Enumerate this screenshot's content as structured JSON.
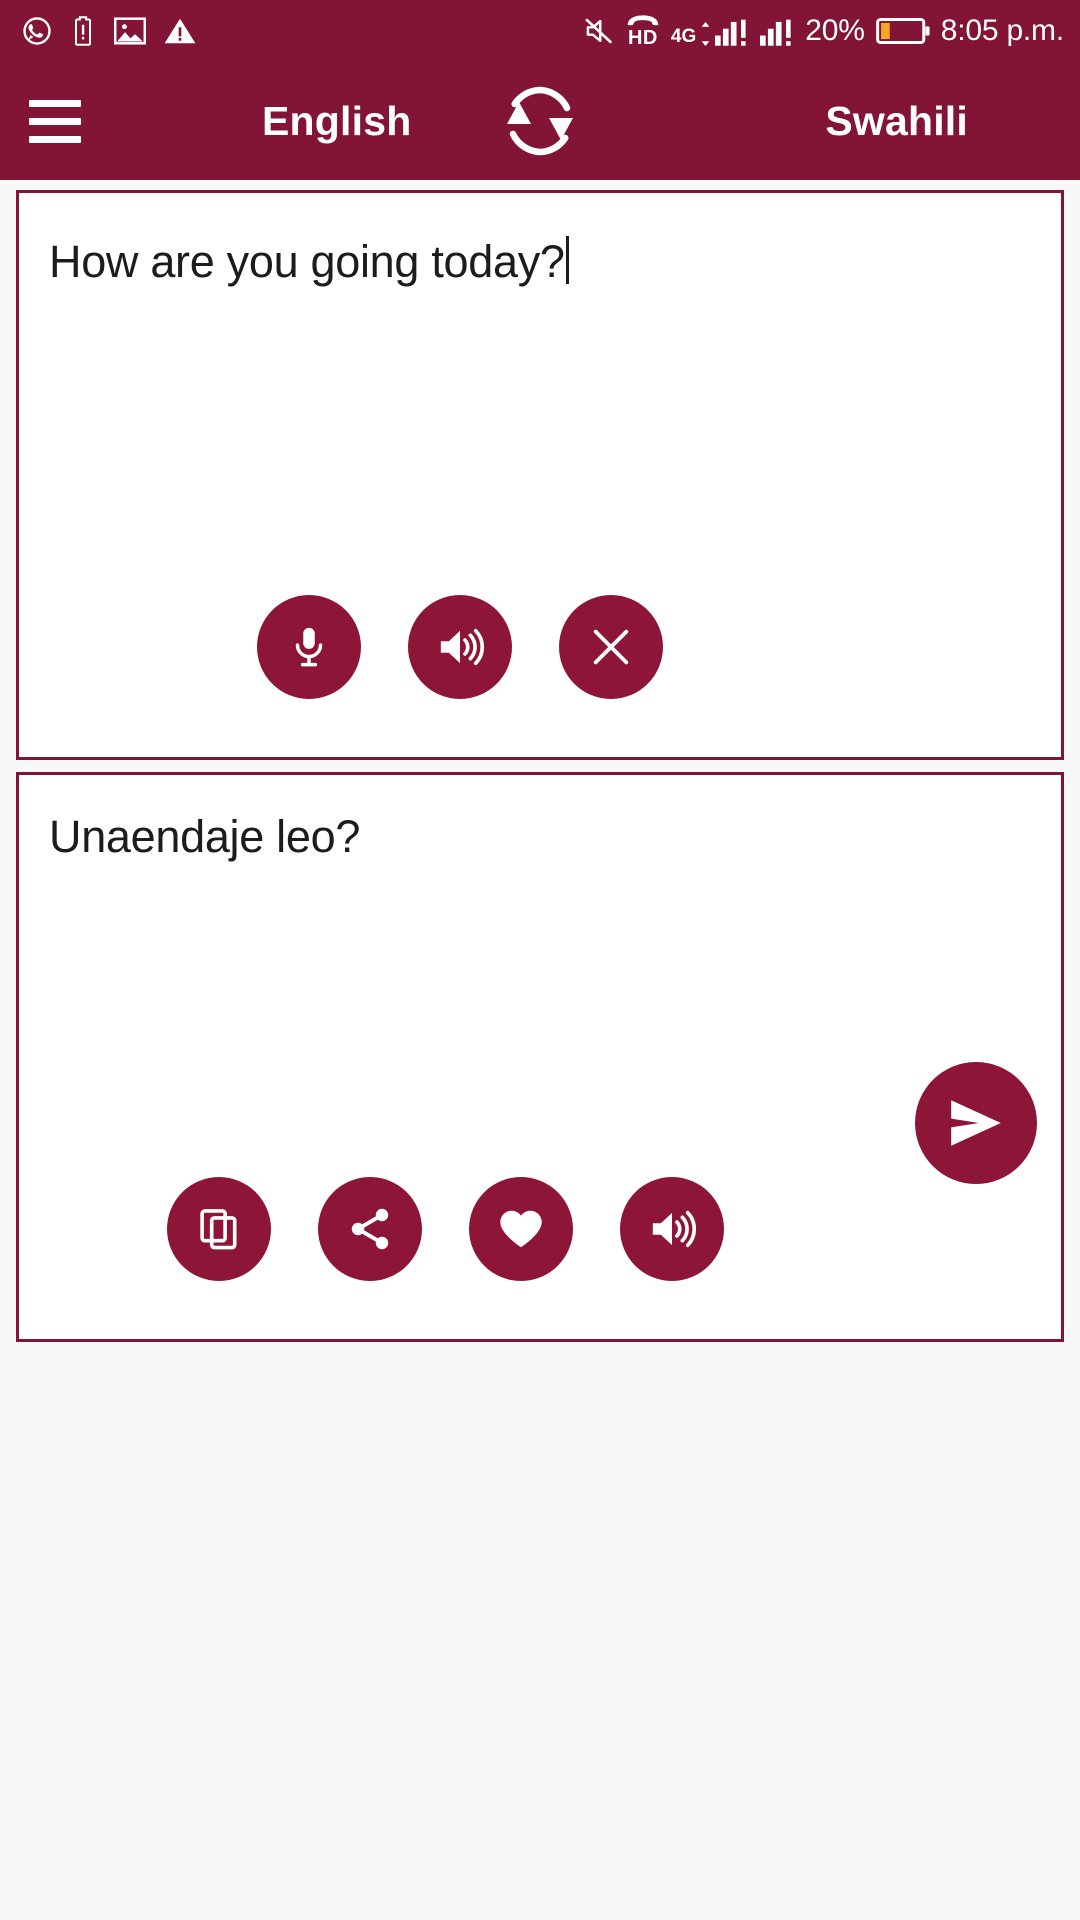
{
  "status_bar": {
    "left_icons": [
      "whatsapp-icon",
      "battery-alert-icon",
      "image-icon",
      "warning-icon"
    ],
    "silent_icon": "mute-icon",
    "hd_label": "HD",
    "network_label": "4G",
    "battery_percent": "20%",
    "battery_level": 20,
    "time": "8:05 p.m.",
    "right_icons": [
      "signal-bars-icon",
      "signal-bars-2-icon",
      "battery-icon"
    ]
  },
  "app_bar": {
    "menu_icon": "hamburger-menu-icon",
    "source_language": "English",
    "swap_icon": "swap-languages-icon",
    "target_language": "Swahili"
  },
  "source_panel": {
    "text": "How are you going today?",
    "has_caret": true,
    "buttons": [
      {
        "name": "microphone-button",
        "icon": "microphone-icon",
        "label": "Speak"
      },
      {
        "name": "speak-source-button",
        "icon": "speaker-icon",
        "label": "Listen"
      },
      {
        "name": "clear-button",
        "icon": "close-icon",
        "label": "Clear"
      }
    ]
  },
  "target_panel": {
    "text": "Unaendaje leo?",
    "buttons": [
      {
        "name": "copy-button",
        "icon": "copy-icon",
        "label": "Copy"
      },
      {
        "name": "share-button",
        "icon": "share-icon",
        "label": "Share"
      },
      {
        "name": "favorite-button",
        "icon": "heart-icon",
        "label": "Favorite"
      },
      {
        "name": "speak-target-button",
        "icon": "speaker-icon",
        "label": "Listen"
      }
    ]
  },
  "send_button": {
    "icon": "send-icon",
    "label": "Translate"
  },
  "colors": {
    "primary": "#821435",
    "button": "#8d1638",
    "on_primary": "#ffffff",
    "background": "#f8f8f8",
    "panel": "#ffffff",
    "text": "#1c1c1c",
    "battery_warn": "#f5a623"
  }
}
